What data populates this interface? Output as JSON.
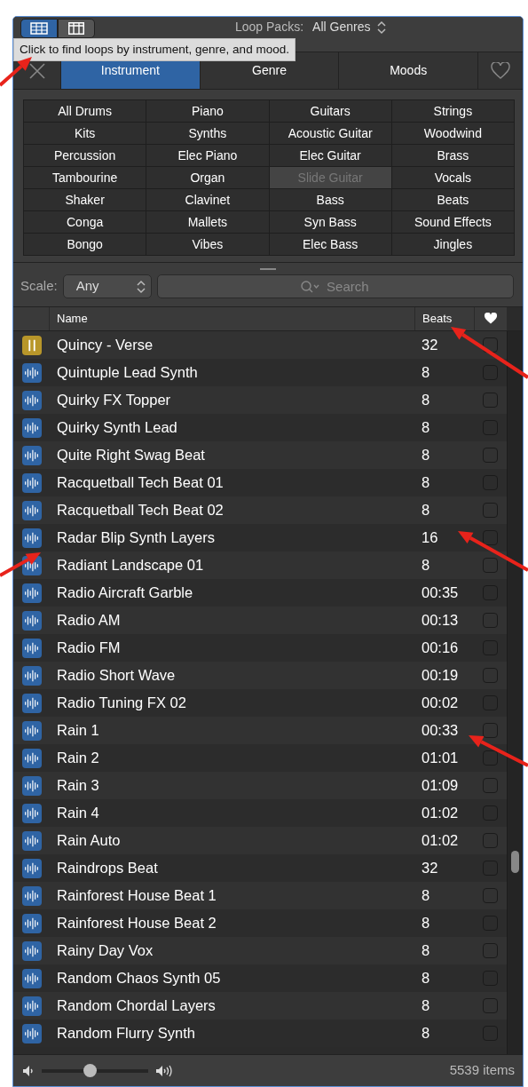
{
  "toolbar": {
    "view_buttons": [
      {
        "kind": "list",
        "selected": true
      },
      {
        "kind": "columns",
        "selected": false
      }
    ],
    "label": "Loop Packs:",
    "value": "All Genres"
  },
  "tooltip": "Click to find loops by instrument, genre, and mood.",
  "tabs": [
    {
      "label": "Instrument",
      "selected": true
    },
    {
      "label": "Genre",
      "selected": false
    },
    {
      "label": "Moods",
      "selected": false
    }
  ],
  "keywords": [
    {
      "label": "All Drums",
      "disabled": false
    },
    {
      "label": "Piano",
      "disabled": false
    },
    {
      "label": "Guitars",
      "disabled": false
    },
    {
      "label": "Strings",
      "disabled": false
    },
    {
      "label": "Kits",
      "disabled": false
    },
    {
      "label": "Synths",
      "disabled": false
    },
    {
      "label": "Acoustic Guitar",
      "disabled": false
    },
    {
      "label": "Woodwind",
      "disabled": false
    },
    {
      "label": "Percussion",
      "disabled": false
    },
    {
      "label": "Elec Piano",
      "disabled": false
    },
    {
      "label": "Elec Guitar",
      "disabled": false
    },
    {
      "label": "Brass",
      "disabled": false
    },
    {
      "label": "Tambourine",
      "disabled": false
    },
    {
      "label": "Organ",
      "disabled": false
    },
    {
      "label": "Slide Guitar",
      "disabled": true
    },
    {
      "label": "Vocals",
      "disabled": false
    },
    {
      "label": "Shaker",
      "disabled": false
    },
    {
      "label": "Clavinet",
      "disabled": false
    },
    {
      "label": "Bass",
      "disabled": false
    },
    {
      "label": "Beats",
      "disabled": false
    },
    {
      "label": "Conga",
      "disabled": false
    },
    {
      "label": "Mallets",
      "disabled": false
    },
    {
      "label": "Syn Bass",
      "disabled": false
    },
    {
      "label": "Sound Effects",
      "disabled": false
    },
    {
      "label": "Bongo",
      "disabled": false
    },
    {
      "label": "Vibes",
      "disabled": false
    },
    {
      "label": "Elec Bass",
      "disabled": false
    },
    {
      "label": "Jingles",
      "disabled": false
    }
  ],
  "filter": {
    "scale_label": "Scale:",
    "scale_value": "Any",
    "search_placeholder": "Search"
  },
  "table": {
    "columns": [
      "Name",
      "Beats"
    ],
    "rows": [
      {
        "kind": "midi",
        "name": "Quincy - Verse",
        "beats": "32",
        "favorite": false
      },
      {
        "kind": "audio",
        "name": "Quintuple Lead Synth",
        "beats": "8",
        "favorite": false
      },
      {
        "kind": "audio",
        "name": "Quirky FX Topper",
        "beats": "8",
        "favorite": false
      },
      {
        "kind": "audio",
        "name": "Quirky Synth Lead",
        "beats": "8",
        "favorite": false
      },
      {
        "kind": "audio",
        "name": "Quite Right Swag Beat",
        "beats": "8",
        "favorite": false
      },
      {
        "kind": "audio",
        "name": "Racquetball Tech Beat 01",
        "beats": "8",
        "favorite": false
      },
      {
        "kind": "audio",
        "name": "Racquetball Tech Beat 02",
        "beats": "8",
        "favorite": false
      },
      {
        "kind": "audio",
        "name": "Radar Blip Synth Layers",
        "beats": "16",
        "favorite": false
      },
      {
        "kind": "audio",
        "name": "Radiant Landscape 01",
        "beats": "8",
        "favorite": false
      },
      {
        "kind": "audio",
        "name": "Radio Aircraft Garble",
        "beats": "00:35",
        "favorite": false
      },
      {
        "kind": "audio",
        "name": "Radio AM",
        "beats": "00:13",
        "favorite": false
      },
      {
        "kind": "audio",
        "name": "Radio FM",
        "beats": "00:16",
        "favorite": false
      },
      {
        "kind": "audio",
        "name": "Radio Short Wave",
        "beats": "00:19",
        "favorite": false
      },
      {
        "kind": "audio",
        "name": "Radio Tuning FX 02",
        "beats": "00:02",
        "favorite": false
      },
      {
        "kind": "audio",
        "name": "Rain 1",
        "beats": "00:33",
        "favorite": false
      },
      {
        "kind": "audio",
        "name": "Rain 2",
        "beats": "01:01",
        "favorite": false
      },
      {
        "kind": "audio",
        "name": "Rain 3",
        "beats": "01:09",
        "favorite": false
      },
      {
        "kind": "audio",
        "name": "Rain 4",
        "beats": "01:02",
        "favorite": false
      },
      {
        "kind": "audio",
        "name": "Rain Auto",
        "beats": "01:02",
        "favorite": false
      },
      {
        "kind": "audio",
        "name": "Raindrops Beat",
        "beats": "32",
        "favorite": false
      },
      {
        "kind": "audio",
        "name": "Rainforest House Beat 1",
        "beats": "8",
        "favorite": false
      },
      {
        "kind": "audio",
        "name": "Rainforest House Beat 2",
        "beats": "8",
        "favorite": false
      },
      {
        "kind": "audio",
        "name": "Rainy Day Vox",
        "beats": "8",
        "favorite": false
      },
      {
        "kind": "audio",
        "name": "Random Chaos Synth 05",
        "beats": "8",
        "favorite": false
      },
      {
        "kind": "audio",
        "name": "Random Chordal Layers",
        "beats": "8",
        "favorite": false
      },
      {
        "kind": "audio",
        "name": "Random Flurry Synth",
        "beats": "8",
        "favorite": false
      }
    ]
  },
  "footer": {
    "volume": {
      "level": 0.45
    },
    "count": "5539 items"
  }
}
